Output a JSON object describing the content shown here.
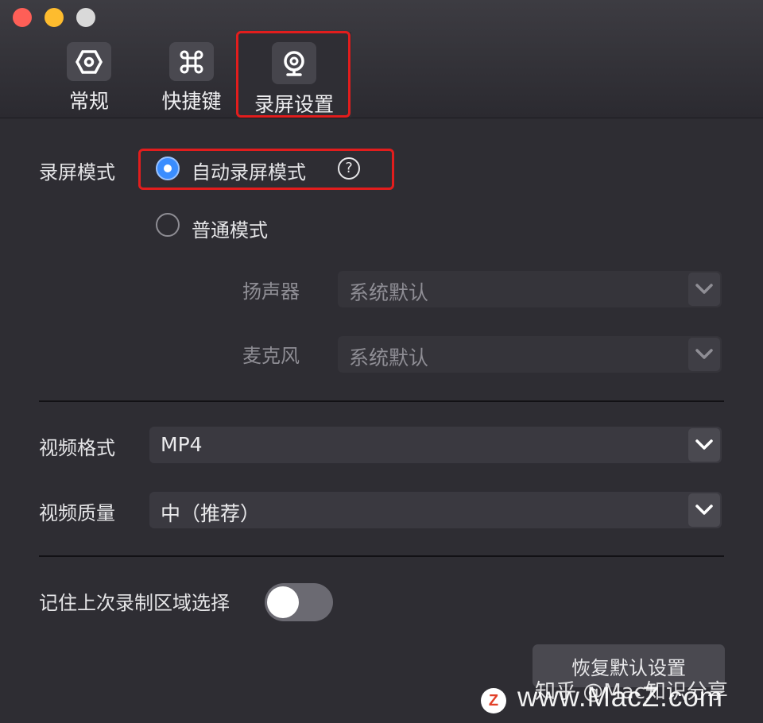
{
  "window": {
    "tabs": [
      {
        "label": "常规",
        "icon": "hexagon-gear-icon"
      },
      {
        "label": "快捷键",
        "icon": "command-icon"
      },
      {
        "label": "录屏设置",
        "icon": "webcam-icon",
        "selected": true
      }
    ]
  },
  "record_mode": {
    "label": "录屏模式",
    "options": [
      {
        "label": "自动录屏模式",
        "selected": true,
        "help": "?"
      },
      {
        "label": "普通模式",
        "selected": false
      }
    ],
    "speaker": {
      "label": "扬声器",
      "value": "系统默认"
    },
    "microphone": {
      "label": "麦克风",
      "value": "系统默认"
    }
  },
  "video": {
    "format": {
      "label": "视频格式",
      "value": "MP4"
    },
    "quality": {
      "label": "视频质量",
      "value": "中（推荐）"
    }
  },
  "remember": {
    "label": "记住上次录制区域选择",
    "enabled": false
  },
  "restore_button": "恢复默认设置",
  "watermark": {
    "credit": "知乎 @Mac知识分享",
    "site": "www.MacZ.com",
    "logo": "Z"
  },
  "colors": {
    "accent": "#3a8dff",
    "highlight": "#e21d1d",
    "background": "#2e2d33"
  }
}
